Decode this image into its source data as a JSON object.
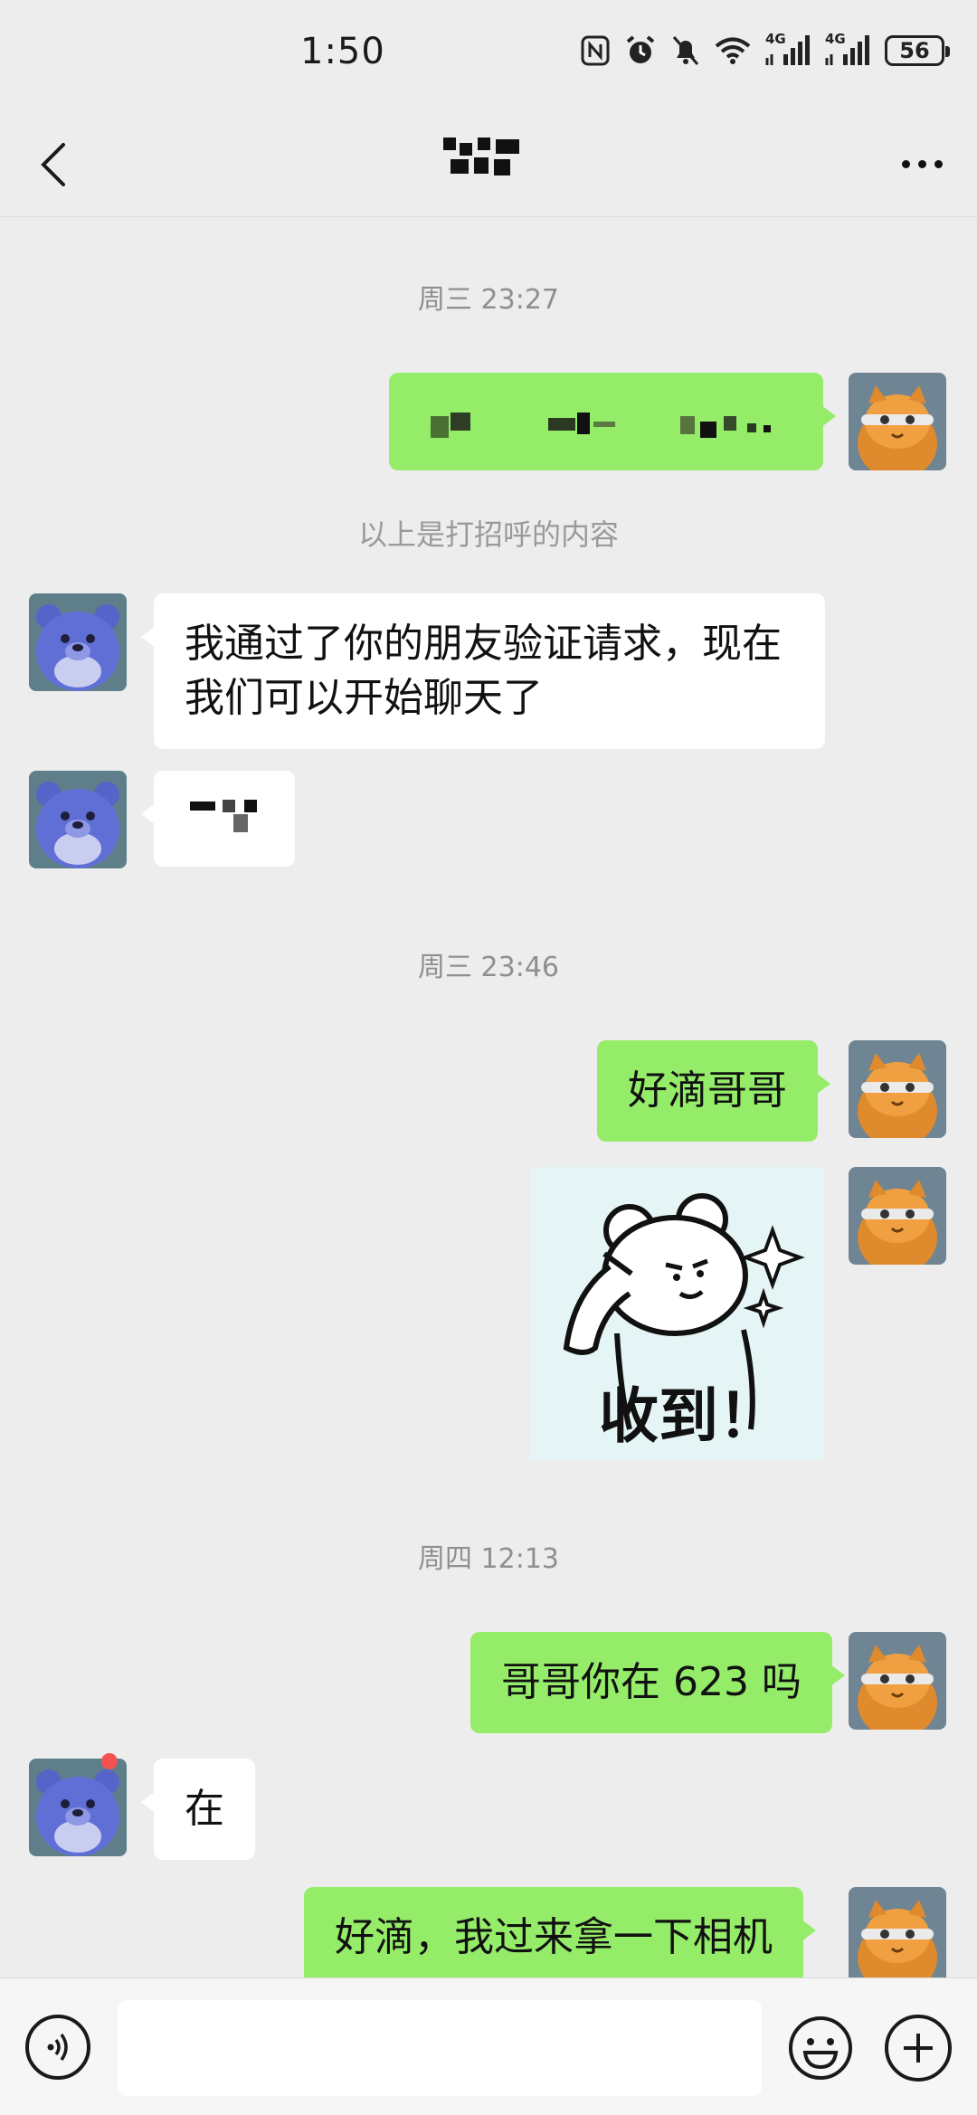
{
  "status_bar": {
    "time": "1:50",
    "network_1": "4G",
    "network_2": "4G",
    "battery": "56"
  },
  "nav": {
    "back_icon": "chevron-left-icon",
    "more_icon": "more-dots-icon"
  },
  "messages": [
    {
      "type": "timestamp",
      "text": "周三 23:27"
    },
    {
      "type": "system",
      "text": "以上是打招呼的内容"
    },
    {
      "type": "text",
      "side": "other",
      "text": "我通过了你的朋友验证请求，现在我们可以开始聊天了"
    },
    {
      "type": "timestamp",
      "text": "周三 23:46"
    },
    {
      "type": "text",
      "side": "me",
      "text": "好滴哥哥"
    },
    {
      "type": "sticker",
      "side": "me",
      "text": "收到！"
    },
    {
      "type": "timestamp",
      "text": "周四 12:13"
    },
    {
      "type": "text",
      "side": "me",
      "text": "哥哥你在 623 吗"
    },
    {
      "type": "text",
      "side": "other",
      "text": "在"
    },
    {
      "type": "text",
      "side": "me",
      "text": "好滴，我过来拿一下相机"
    }
  ],
  "input_bar": {
    "voice_icon": "voice-icon",
    "emoji_icon": "emoji-icon",
    "plus_icon": "plus-icon"
  },
  "colors": {
    "background": "#ededed",
    "my_bubble": "#95ec69",
    "other_bubble": "#ffffff",
    "unread_dot": "#f45151"
  }
}
